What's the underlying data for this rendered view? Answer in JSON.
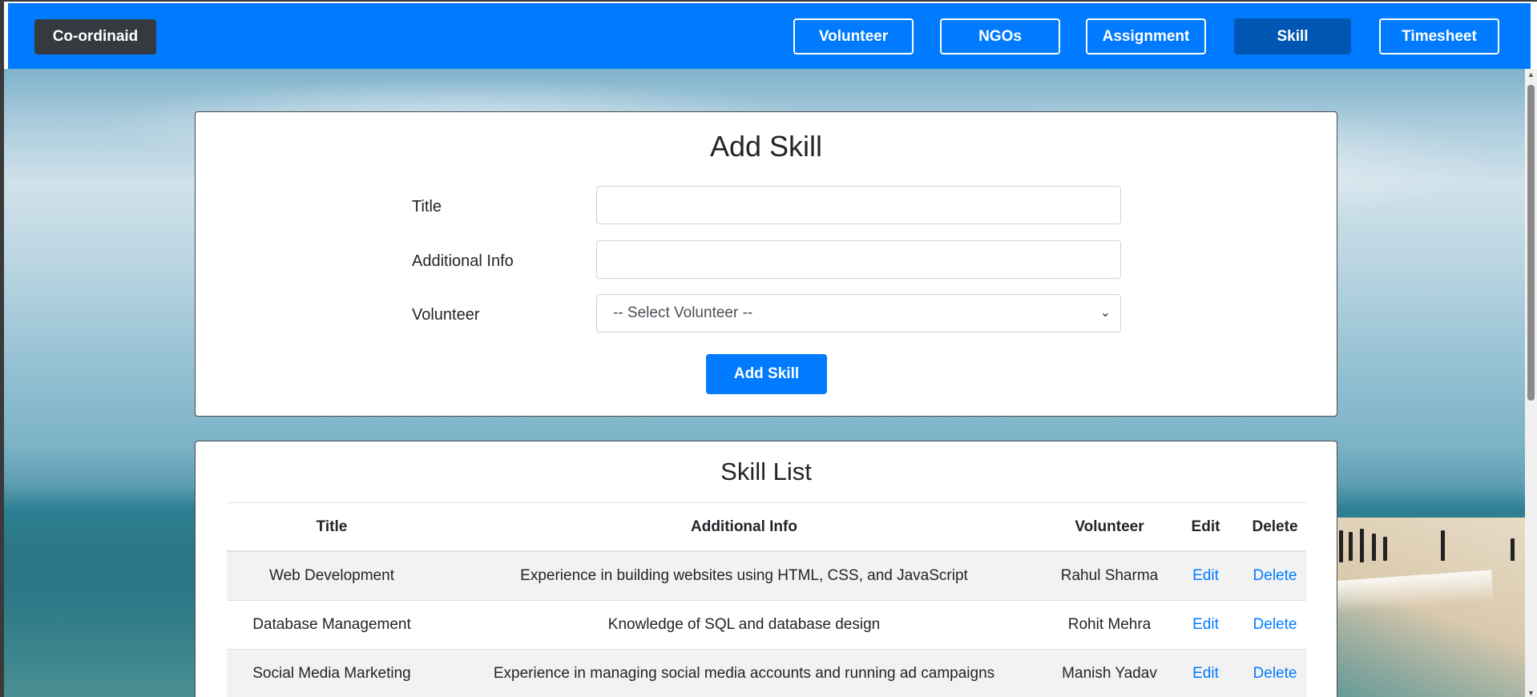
{
  "brand": "Co-ordinaid",
  "nav": {
    "items": [
      {
        "label": "Volunteer"
      },
      {
        "label": "NGOs"
      },
      {
        "label": "Assignment"
      },
      {
        "label": "Skill"
      },
      {
        "label": "Timesheet"
      }
    ],
    "active": "Skill"
  },
  "add_form": {
    "heading": "Add Skill",
    "title_label": "Title",
    "title_value": "",
    "info_label": "Additional Info",
    "info_value": "",
    "volunteer_label": "Volunteer",
    "volunteer_selected": "-- Select Volunteer --",
    "submit_label": "Add Skill"
  },
  "skill_list": {
    "heading": "Skill List",
    "columns": [
      "Title",
      "Additional Info",
      "Volunteer",
      "Edit",
      "Delete"
    ],
    "rows": [
      {
        "title": "Web Development",
        "info": "Experience in building websites using HTML, CSS, and JavaScript",
        "volunteer": "Rahul Sharma",
        "edit": "Edit",
        "delete": "Delete"
      },
      {
        "title": "Database Management",
        "info": "Knowledge of SQL and database design",
        "volunteer": "Rohit Mehra",
        "edit": "Edit",
        "delete": "Delete"
      },
      {
        "title": "Social Media Marketing",
        "info": "Experience in managing social media accounts and running ad campaigns",
        "volunteer": "Manish Yadav",
        "edit": "Edit",
        "delete": "Delete"
      }
    ]
  },
  "colors": {
    "primary": "#007bff",
    "active_nav": "#0056b3",
    "brand_bg": "#343a40",
    "link": "#007bff"
  },
  "icons": {
    "select_chevron": "chevron-down-icon",
    "scroll_up": "scroll-up-arrow-icon",
    "scroll_down": "scroll-down-arrow-icon"
  }
}
